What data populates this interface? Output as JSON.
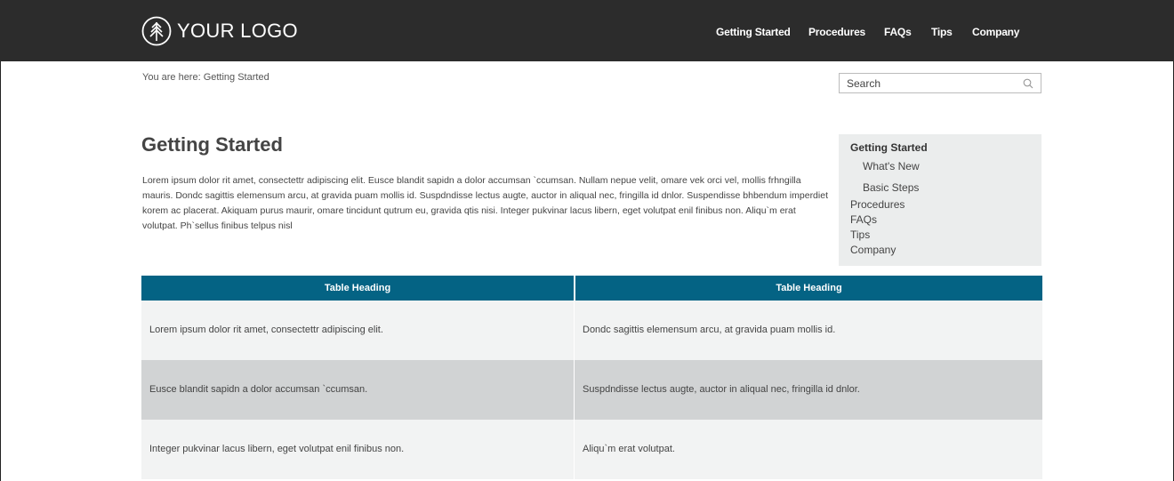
{
  "header": {
    "logo_text": "YOUR LOGO",
    "nav": [
      "Getting Started",
      "Procedures",
      "FAQs",
      "Tips",
      "Company"
    ]
  },
  "breadcrumb": "You are here: Getting Started",
  "search": {
    "placeholder": "Search"
  },
  "main": {
    "title": "Getting Started",
    "intro": "Lorem ipsum dolor rit amet, consectettr adipiscing elit. Eusce blandit sapidn a dolor accumsan `ccumsan. Nullam nepue velit, omare vek orci vel, mollis frhngilla mauris. Dondc sagittis elemensum arcu, at gravida puam mollis id. Suspdndisse lectus augte, auctor in aliqual nec, fringilla id dnlor. Suspendisse bhbendum imperdiet korem ac placerat. Akiquam purus maurir, omare tincidunt qutrum eu, gravida qtis nisi. Integer pukvinar lacus libern, eget volutpat enil finibus non. Aliqu`m erat volutpat. Ph`sellus finibus telpus nisl"
  },
  "sidebar": {
    "heading": "Getting Started",
    "subitems": [
      "What's New",
      "Basic Steps"
    ],
    "items": [
      "Procedures",
      "FAQs",
      "Tips",
      "Company"
    ]
  },
  "table": {
    "headers": [
      "Table Heading",
      "Table Heading"
    ],
    "rows": [
      [
        "Lorem ipsum dolor rit amet, consectettr adipiscing elit.",
        "Dondc sagittis elemensum arcu, at gravida puam mollis id."
      ],
      [
        "Eusce blandit sapidn a dolor accumsan `ccumsan.",
        "Suspdndisse lectus augte, auctor in aliqual nec, fringilla id dnlor."
      ],
      [
        "Integer pukvinar lacus libern, eget volutpat enil finibus non.",
        "Aliqu`m erat volutpat."
      ]
    ],
    "row_colors": [
      "#f2f3f3",
      "#d1d3d4",
      "#f2f3f3"
    ],
    "header_color": "#046384"
  },
  "colors": {
    "topbar": "#2c2c2c",
    "accent": "#046384",
    "sidebar_bg": "#ebeded"
  },
  "icons": {
    "logo": "tree-logo-icon",
    "search": "search-icon"
  }
}
